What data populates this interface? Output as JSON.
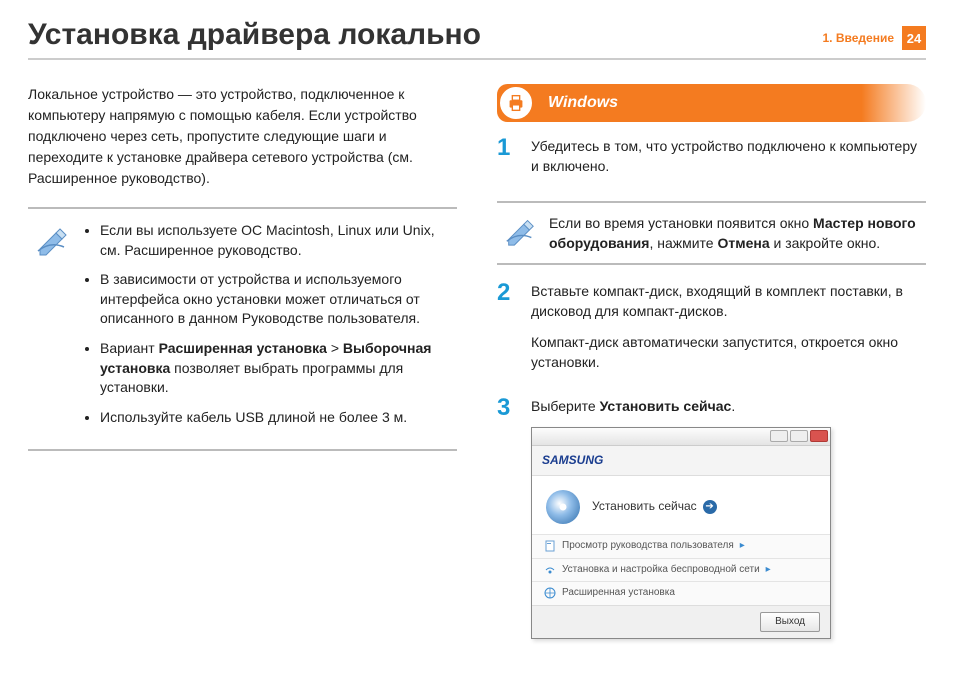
{
  "header": {
    "title": "Установка драйвера локально",
    "section": "1.  Введение",
    "page": "24"
  },
  "left": {
    "intro": "Локальное устройство — это устройство, подключенное к компьютеру напрямую с помощью кабеля. Если устройство подключено через сеть, пропустите следующие шаги и переходите к установке драйвера сетевого устройства (см. Расширенное руководство).",
    "notes": {
      "item1": "Если вы используете ОС Macintosh, Linux или Unix, см. Расширенное руководство.",
      "item2": "В зависимости от устройства и используемого интерфейса окно установки может отличаться от описанного в данном Руководстве пользователя.",
      "item3_pre": "Вариант ",
      "item3_b1": "Расширенная установка",
      "item3_gt": " > ",
      "item3_b2": "Выборочная установка",
      "item3_post": " позволяет выбрать программы для установки.",
      "item4": "Используйте кабель USB длиной не более 3 м."
    }
  },
  "right": {
    "section_title": "Windows",
    "step1": "Убедитесь в том, что устройство подключено к компьютеру и включено.",
    "note_pre": "Если во время установки появится окно ",
    "note_b1": "Мастер нового оборудования",
    "note_mid": ", нажмите ",
    "note_b2": "Отмена",
    "note_post": " и закройте окно.",
    "step2a": "Вставьте компакт-диск, входящий в комплект поставки, в дисковод для компакт-дисков.",
    "step2b": "Компакт-диск автоматически запустится, откроется окно установки.",
    "step3_pre": "Выберите ",
    "step3_b": "Установить сейчас",
    "step3_post": ".",
    "dialog": {
      "logo": "SAMSUNG",
      "install_now": "Установить сейчас",
      "row1": "Просмотр руководства пользователя",
      "row2": "Установка и настройка беспроводной сети",
      "row3": "Расширенная установка",
      "exit": "Выход"
    },
    "nums": {
      "n1": "1",
      "n2": "2",
      "n3": "3"
    }
  }
}
